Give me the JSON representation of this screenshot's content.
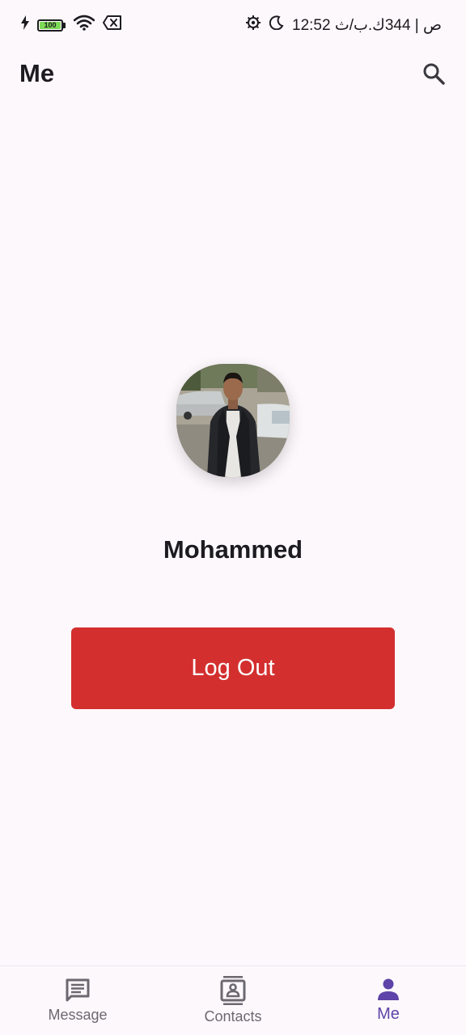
{
  "status_bar": {
    "battery_level": "100",
    "right_text": "12:52 ص | 344ك.ب/ث"
  },
  "app_bar": {
    "title": "Me"
  },
  "profile": {
    "name": "Mohammed"
  },
  "actions": {
    "logout_label": "Log Out"
  },
  "bottom_nav": {
    "items": [
      {
        "label": "Message",
        "icon": "message-icon"
      },
      {
        "label": "Contacts",
        "icon": "contacts-icon"
      },
      {
        "label": "Me",
        "icon": "person-icon",
        "active": true
      }
    ]
  },
  "colors": {
    "background": "#fdf8fc",
    "logout_button": "#d32f2f",
    "nav_active": "#5e43a8",
    "nav_inactive": "#6b6870"
  }
}
